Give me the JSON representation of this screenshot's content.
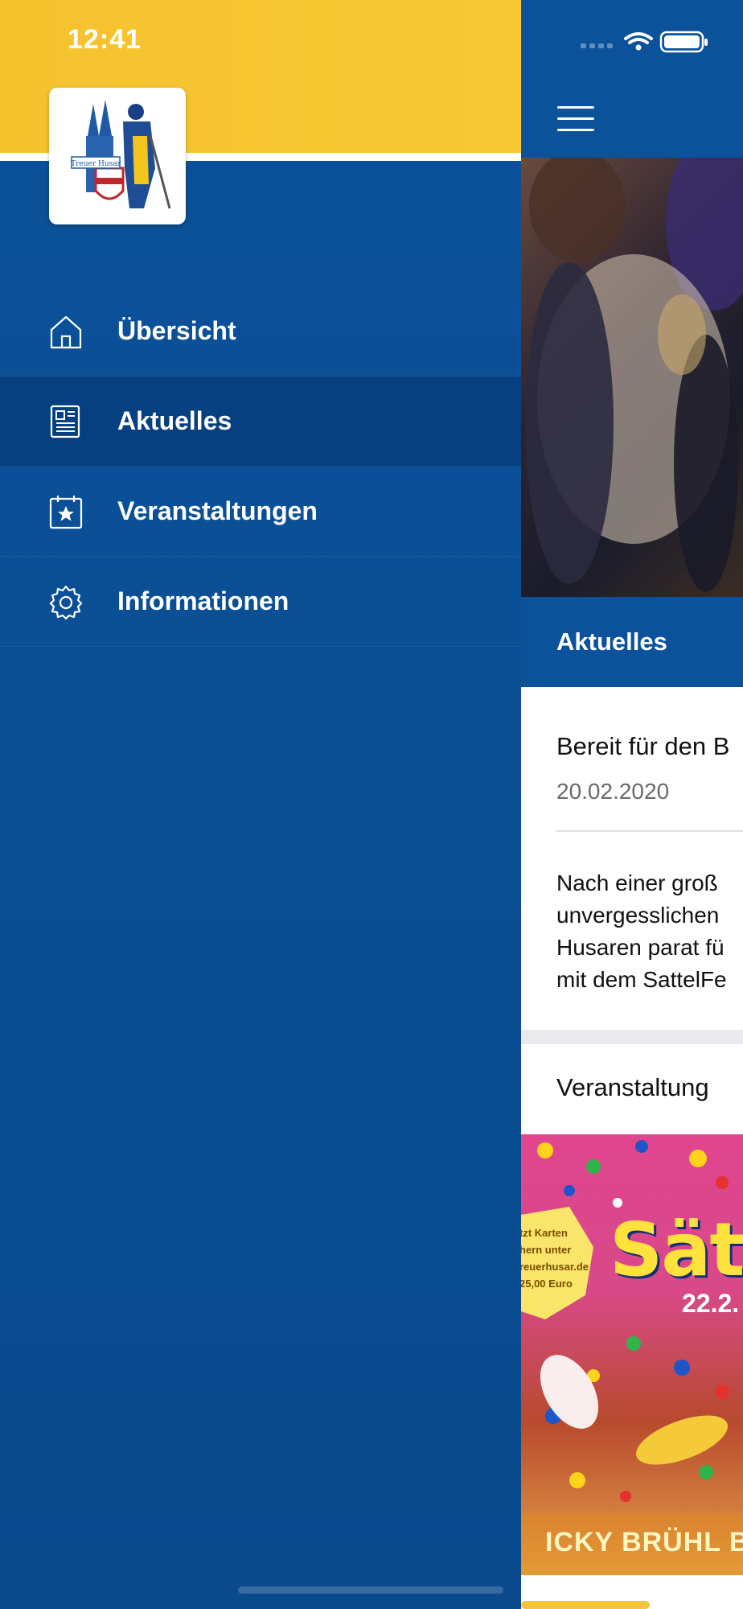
{
  "status_bar": {
    "time": "12:41"
  },
  "drawer": {
    "logo": {
      "text": "Treuer Husar"
    },
    "menu": [
      {
        "label": "Übersicht",
        "icon": "home-icon",
        "active": false
      },
      {
        "label": "Aktuelles",
        "icon": "newspaper-icon",
        "active": true
      },
      {
        "label": "Veranstaltungen",
        "icon": "calendar-star-icon",
        "active": false
      },
      {
        "label": "Informationen",
        "icon": "gear-icon",
        "active": false
      }
    ]
  },
  "main": {
    "section_title": "Aktuelles",
    "news": {
      "title": "Bereit für den B",
      "date": "20.02.2020",
      "body": [
        "Nach einer groß",
        "unvergesslichen",
        "Husaren parat fü",
        "mit dem SattelFe"
      ]
    },
    "events_title": "Veranstaltung",
    "poster": {
      "title": "Säte",
      "date": "22.2.",
      "side_text": [
        "tzt Karten",
        "hern unter",
        "reuerhusar.de",
        "25,00 Euro"
      ],
      "band_text": "ICKY BRÜHL BAN"
    }
  },
  "colors": {
    "primary_blue": "#0b529a",
    "accent_yellow": "#f5c22e",
    "white": "#ffffff"
  }
}
